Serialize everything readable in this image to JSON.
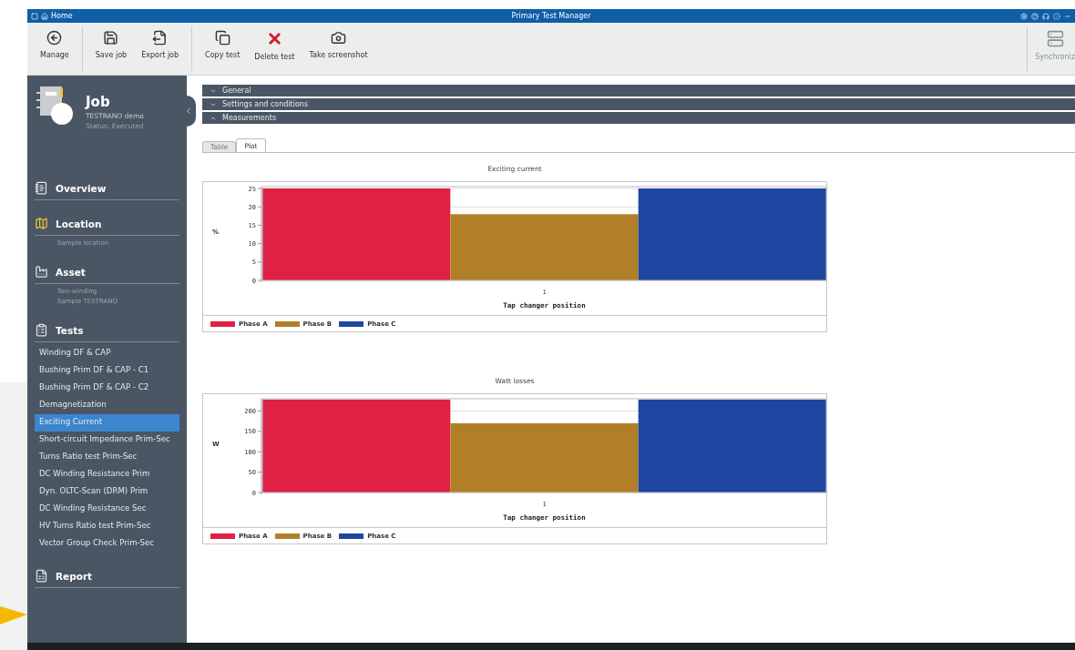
{
  "window": {
    "tab": "Home",
    "title": "Primary Test Manager"
  },
  "toolbar": {
    "groups": [
      [
        {
          "label": "Manage",
          "kind": "back",
          "disabled": false
        }
      ],
      [
        {
          "label": "Save job",
          "kind": "save",
          "disabled": false
        },
        {
          "label": "Export job",
          "kind": "export",
          "disabled": false
        }
      ],
      [
        {
          "label": "Copy test",
          "kind": "copy",
          "disabled": false
        },
        {
          "label": "Delete test",
          "kind": "delete",
          "disabled": false
        },
        {
          "label": "Take screenshot",
          "kind": "camera",
          "disabled": false
        }
      ]
    ],
    "right": {
      "label": "Synchroniz",
      "kind": "sync",
      "disabled": true
    }
  },
  "sidebar": {
    "job": {
      "title": "Job",
      "name": "TESTRANO demo",
      "status": "Status: Executed"
    },
    "sections": [
      {
        "title": "Overview",
        "kind": "overview"
      },
      {
        "title": "Location",
        "kind": "location",
        "details": [
          "Sample location"
        ]
      },
      {
        "title": "Asset",
        "kind": "asset",
        "details": [
          "Two-winding",
          "Sample TESTRANO"
        ]
      },
      {
        "title": "Tests",
        "kind": "tests",
        "items": [
          {
            "label": "Winding DF & CAP",
            "selected": false
          },
          {
            "label": "Bushing Prim DF & CAP - C1",
            "selected": false
          },
          {
            "label": "Bushing Prim DF & CAP - C2",
            "selected": false
          },
          {
            "label": "Demagnetization",
            "selected": false
          },
          {
            "label": "Exciting Current",
            "selected": true
          },
          {
            "label": "Short-circuit Impedance Prim-Sec",
            "selected": false
          },
          {
            "label": "Turns Ratio test Prim-Sec",
            "selected": false
          },
          {
            "label": "DC Winding Resistance Prim",
            "selected": false
          },
          {
            "label": "Dyn. OLTC-Scan (DRM) Prim",
            "selected": false
          },
          {
            "label": "DC Winding Resistance Sec",
            "selected": false
          },
          {
            "label": "HV Turns Ratio test Prim-Sec",
            "selected": false
          },
          {
            "label": "Vector Group Check Prim-Sec",
            "selected": false
          }
        ]
      },
      {
        "title": "Report",
        "kind": "report"
      }
    ]
  },
  "accordion": [
    {
      "title": "General",
      "expanded": false
    },
    {
      "title": "Settings and conditions",
      "expanded": false
    },
    {
      "title": "Measurements",
      "expanded": true
    }
  ],
  "tabs": [
    {
      "label": "Table",
      "selected": false
    },
    {
      "label": "Plot",
      "selected": true
    }
  ],
  "charts": [
    {
      "chart_data": {
        "type": "bar",
        "title": "Exciting current",
        "xlabel": "Tap changer position",
        "ylabel": "%",
        "categories": [
          "1"
        ],
        "series": [
          {
            "name": "Phase A",
            "color": "#e02044",
            "values": [
              25
            ]
          },
          {
            "name": "Phase B",
            "color": "#b07f28",
            "values": [
              18
            ]
          },
          {
            "name": "Phase C",
            "color": "#1e46a0",
            "values": [
              25
            ]
          }
        ],
        "ylim": [
          0,
          25.5
        ],
        "yticks": [
          0,
          5,
          10,
          15,
          20,
          25
        ],
        "grid": true
      }
    },
    {
      "chart_data": {
        "type": "bar",
        "title": "Watt losses",
        "xlabel": "Tap changer position",
        "ylabel": "W",
        "categories": [
          "1"
        ],
        "series": [
          {
            "name": "Phase A",
            "color": "#e02044",
            "values": [
              228
            ]
          },
          {
            "name": "Phase B",
            "color": "#b07f28",
            "values": [
              170
            ]
          },
          {
            "name": "Phase C",
            "color": "#1e46a0",
            "values": [
              228
            ]
          }
        ],
        "ylim": [
          0,
          230
        ],
        "yticks": [
          0,
          50,
          100,
          150,
          200
        ],
        "grid": true
      }
    }
  ]
}
